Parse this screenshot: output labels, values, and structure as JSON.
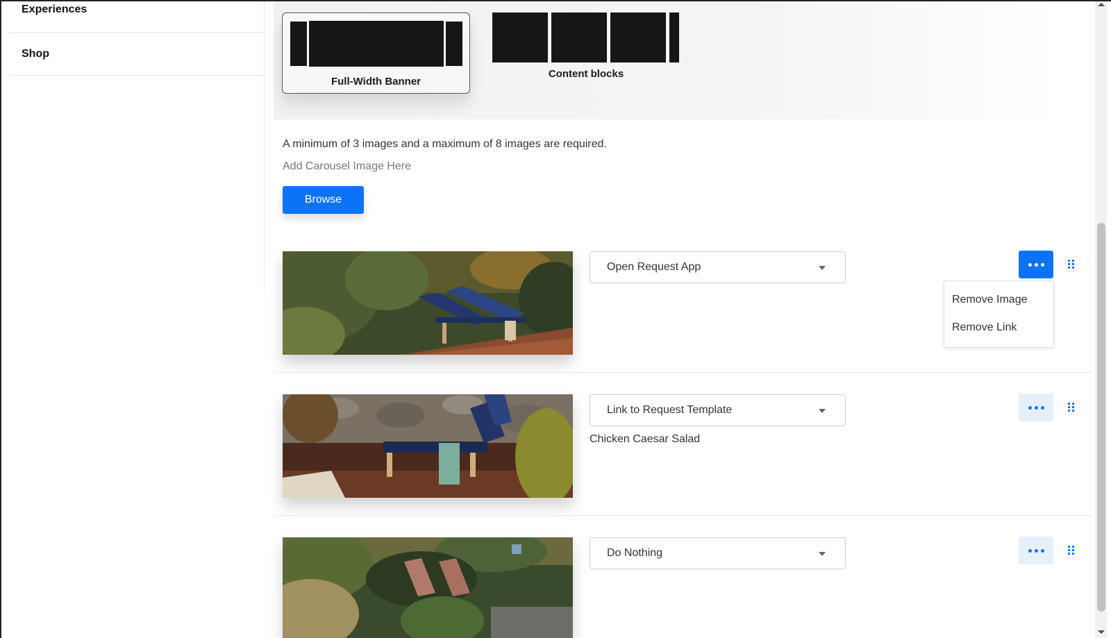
{
  "sidebar": {
    "items": [
      {
        "label": "Experiences"
      },
      {
        "label": "Shop"
      }
    ]
  },
  "layout_options": {
    "banner_label": "Full-Width Banner",
    "blocks_label": "Content blocks",
    "selected": "Full-Width Banner"
  },
  "carousel": {
    "info_text": "A minimum of 3 images and a maximum of 8 images are required.",
    "add_text": "Add Carousel Image Here",
    "browse_label": "Browse",
    "items": [
      {
        "image": "garden-sun-loungers",
        "action": "Open Request App",
        "sub_value": ""
      },
      {
        "image": "poolside-lounger-stone-wall",
        "action": "Link to Request Template",
        "sub_value": "Chicken Caesar Salad"
      },
      {
        "image": "deck-chairs-in-garden",
        "action": "Do Nothing",
        "sub_value": ""
      }
    ]
  },
  "context_menu": {
    "items": [
      "Remove Image",
      "Remove Link"
    ]
  },
  "colors": {
    "accent": "#0c73f8",
    "accent_light": "#e6f0fc"
  }
}
